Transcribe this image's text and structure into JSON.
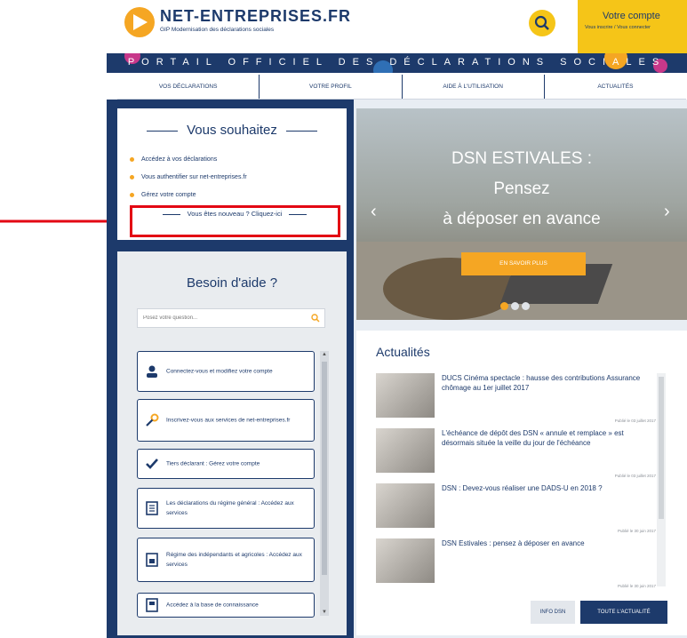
{
  "header": {
    "logo_title": "NET-ENTREPRISES.FR",
    "logo_subtitle": "GIP Modernisation des déclarations sociales",
    "account_title": "Votre compte",
    "account_subtitle": "Vous inscrire / Vous connecter"
  },
  "banner": {
    "text": "PORTAIL OFFICIEL DES DÉCLARATIONS SOCIALES"
  },
  "nav": {
    "items": [
      "VOS DÉCLARATIONS",
      "VOTRE PROFIL",
      "AIDE À L'UTILISATION",
      "ACTUALITÉS"
    ]
  },
  "souhaitez": {
    "title": "Vous souhaitez",
    "links": [
      "Accédez à vos déclarations",
      "Vous authentifier sur net-entreprises.fr",
      "Gérez votre compte"
    ],
    "new_user": "Vous êtes nouveau ? Cliquez-ici"
  },
  "aide": {
    "title": "Besoin d'aide ?",
    "search_placeholder": "Posez votre question...",
    "cards": [
      "Connectez-vous et modifiez votre compte",
      "Inscrivez-vous aux services de net-entreprises.fr",
      "Tiers déclarant : Gérez votre compte",
      "Les déclarations du régime général : Accédez aux services",
      "Régime des indépendants et agricoles : Accédez aux services",
      "Accédez à la base de connaissance"
    ]
  },
  "slider": {
    "line1": "DSN ESTIVALES :",
    "line2": "Pensez",
    "line3": "à déposer en avance",
    "cta": "EN SAVOIR PLUS",
    "prev": "‹",
    "next": "›"
  },
  "actualites": {
    "title": "Actualités",
    "items": [
      {
        "text": "DUCS Cinéma spectacle : hausse des contributions Assurance chômage au 1er juillet 2017",
        "date": "Publié le 03 juillet 2017"
      },
      {
        "text": "L'échéance de dépôt des DSN « annule et remplace » est désormais située la veille du jour de l'échéance",
        "date": "Publié le 03 juillet 2017"
      },
      {
        "text": "DSN : Devez-vous réaliser une DADS-U en 2018 ?",
        "date": "Publié le 30 juin 2017"
      },
      {
        "text": "DSN Estivales : pensez à déposer en avance",
        "date": "Publié le 30 juin 2017"
      }
    ],
    "btn_infos": "INFO DSN",
    "btn_toute": "TOUTE L'ACTUALITÉ"
  },
  "colors": {
    "brand_navy": "#1d3a6b",
    "accent_yellow": "#f5c518",
    "accent_orange": "#f5a623",
    "highlight_red": "#e30613"
  }
}
